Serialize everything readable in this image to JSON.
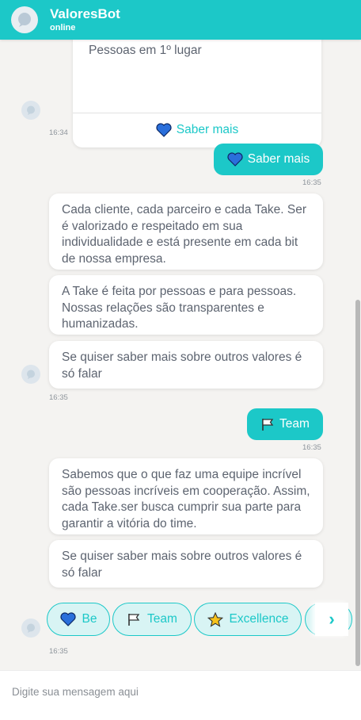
{
  "header": {
    "title": "ValoresBot",
    "status": "online",
    "avatar_icon": "bot-chat-icon",
    "color": "#1cc8c8"
  },
  "messages": {
    "top_card": {
      "text": "Pessoas em 1º lugar",
      "link_label": "Saber mais",
      "link_icon": "blue-heart-icon",
      "time": "16:34"
    },
    "user_1": {
      "label": "Saber mais",
      "icon": "blue-heart-icon",
      "time": "16:35"
    },
    "bot_group_1": {
      "bubbles": [
        "Cada cliente, cada parceiro e cada Take. Ser é valorizado e respeitado em sua individualidade e está presente em cada bit de nossa empresa.",
        "A Take é feita por pessoas e para pessoas. Nossas relações são transparentes e humanizadas.",
        "Se quiser saber mais sobre outros valores é só falar"
      ],
      "time": "16:35"
    },
    "user_2": {
      "label": "Team",
      "icon": "flag-icon",
      "time": "16:35"
    },
    "bot_group_2": {
      "bubbles": [
        "Sabemos que o que faz uma equipe incrível são pessoas incríveis em cooperação. Assim, cada Take.ser busca cumprir sua parte para garantir a vitória do time.",
        "Se quiser saber mais sobre outros valores é só falar"
      ],
      "time": "16:35"
    }
  },
  "quick_replies": {
    "items": [
      {
        "label": "Be",
        "icon": "blue-heart-icon"
      },
      {
        "label": "Team",
        "icon": "flag-icon"
      },
      {
        "label": "Excellence",
        "icon": "star-icon"
      },
      {
        "label": "",
        "icon": ""
      }
    ],
    "next_icon": "chevron-right-icon"
  },
  "composer": {
    "placeholder": "Digite sua mensagem aqui"
  },
  "colors": {
    "accent": "#1cc8c8",
    "chip_bg": "#d8f4f4",
    "heart": "#2a6fdb",
    "background": "#f4f3f1",
    "text": "#5d6470"
  }
}
